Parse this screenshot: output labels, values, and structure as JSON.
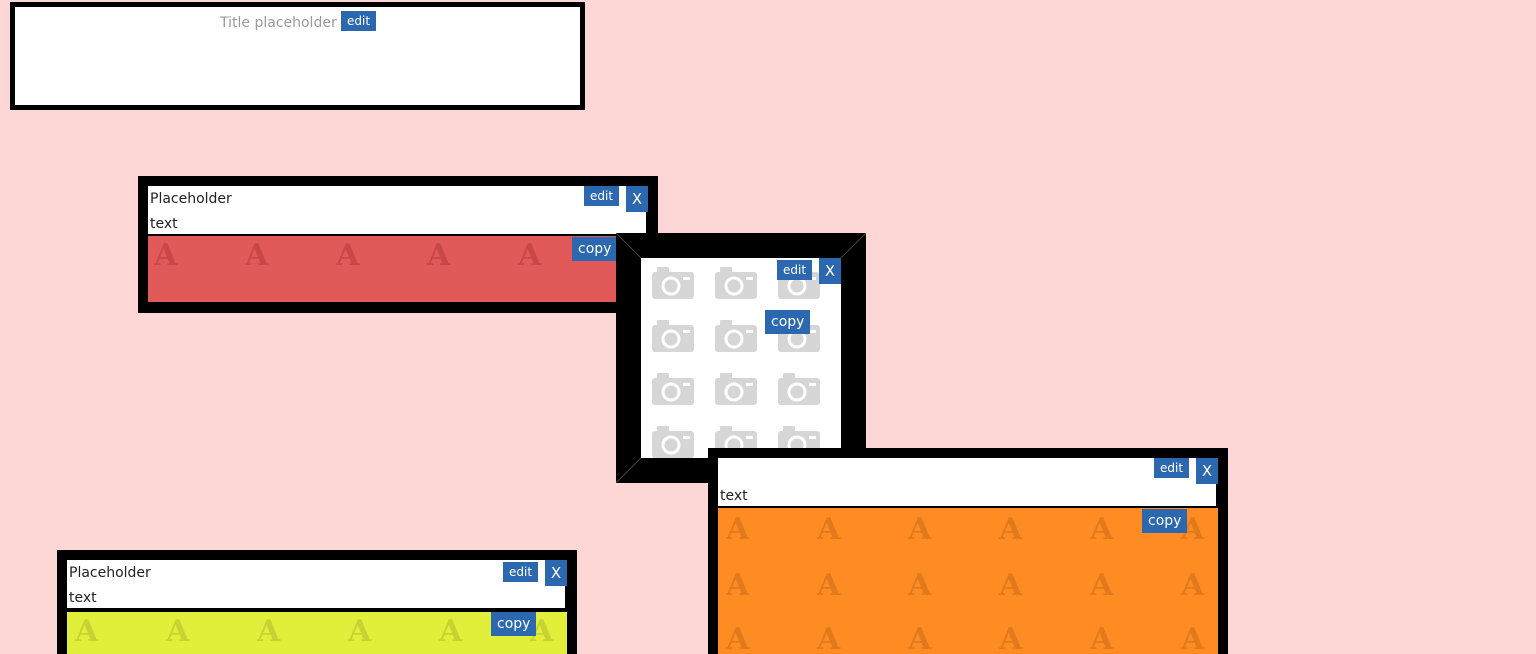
{
  "title_box": {
    "placeholder": "Title placeholder",
    "edit_label": "edit"
  },
  "cards": {
    "red": {
      "line1": "Placeholder",
      "line2": "text",
      "edit_label": "edit",
      "close_label": "X",
      "copy_label": "copy",
      "pattern_glyph": "A",
      "color": "#e15959"
    },
    "photo": {
      "edit_label": "edit",
      "close_label": "X",
      "copy_label": "copy",
      "icon": "camera-icon"
    },
    "orange": {
      "line2": "text",
      "edit_label": "edit",
      "close_label": "X",
      "copy_label": "copy",
      "pattern_glyph": "A",
      "color": "#ff8c22"
    },
    "yellow": {
      "line1": "Placeholder",
      "line2": "text",
      "edit_label": "edit",
      "close_label": "X",
      "copy_label": "copy",
      "pattern_glyph": "A",
      "color": "#e2ef3a"
    }
  },
  "colors": {
    "background": "#fdd6d6",
    "button": "#2c68b0",
    "frame": "#000000"
  }
}
